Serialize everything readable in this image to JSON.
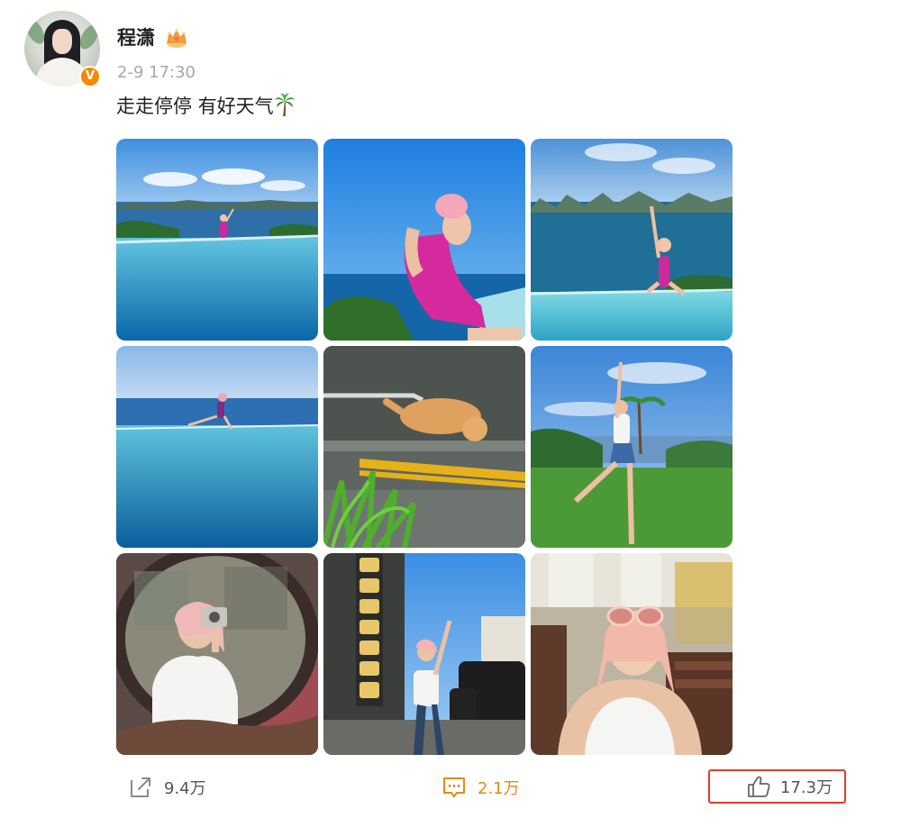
{
  "post": {
    "author": "程潇",
    "timestamp": "2-9 17:30",
    "text": "走走停停 有好天气",
    "verified_badge": "V",
    "text_emoji": "palm-tree-icon",
    "author_badge": "crown-icon"
  },
  "photos": [
    {
      "name": "photo-1-infinity-pool-wave",
      "scene": "infinity pool by the sea, woman waving"
    },
    {
      "name": "photo-2-pink-swimsuit-pose",
      "scene": "woman in pink swimsuit leaning back, blue sky"
    },
    {
      "name": "photo-3-pool-with-islands",
      "scene": "woman sitting on pool edge, islands behind"
    },
    {
      "name": "photo-4-horizon-pool",
      "scene": "woman sitting at horizon of infinity pool"
    },
    {
      "name": "photo-5-sleeping-cat",
      "scene": "orange cat sleeping on pavement"
    },
    {
      "name": "photo-6-lawn-jump",
      "scene": "woman posing on green lawn, palm trees"
    },
    {
      "name": "photo-7-mirror-selfie",
      "scene": "mirror selfie with camera, ornate frame"
    },
    {
      "name": "photo-8-street-pose",
      "scene": "woman on street with signs and cars"
    },
    {
      "name": "photo-9-sunglasses-selfie",
      "scene": "woman with sunglasses on head, white tank top"
    }
  ],
  "actions": {
    "share_count": "9.4万",
    "comment_count": "2.1万",
    "like_count": "17.3万"
  },
  "colors": {
    "timestamp": "#a8a8a8",
    "comment_accent": "#e48b15",
    "highlight_border": "#e53a2c",
    "verified_badge": "#f28a00"
  }
}
